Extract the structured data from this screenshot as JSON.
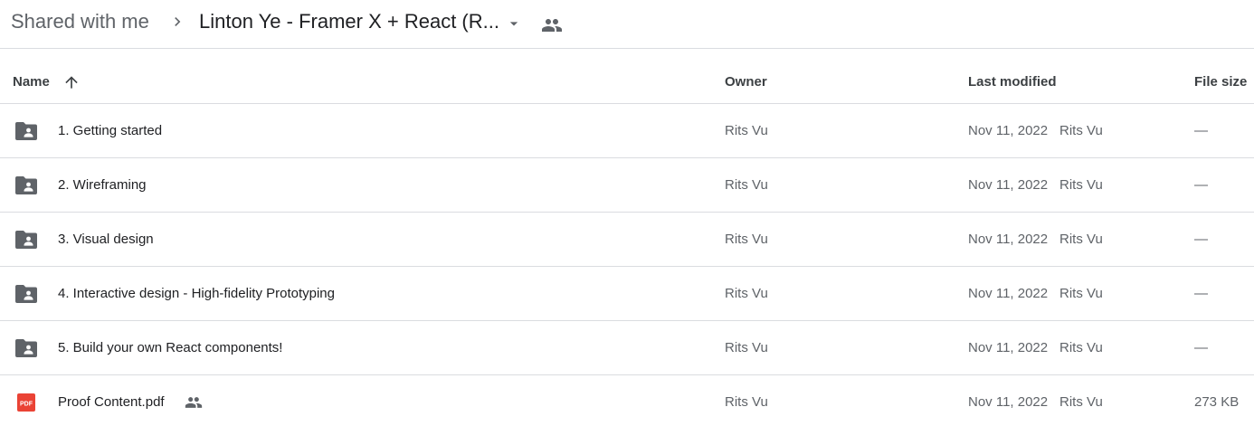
{
  "breadcrumb": {
    "root": "Shared with me",
    "current": "Linton Ye - Framer X + React (R..."
  },
  "columns": {
    "name": "Name",
    "owner": "Owner",
    "last_modified": "Last modified",
    "file_size": "File size"
  },
  "rows": [
    {
      "name": "1. Getting started",
      "type": "shared-folder",
      "owner": "Rits Vu",
      "modified_date": "Nov 11, 2022",
      "modified_by": "Rits Vu",
      "size": "—"
    },
    {
      "name": "2. Wireframing",
      "type": "shared-folder",
      "owner": "Rits Vu",
      "modified_date": "Nov 11, 2022",
      "modified_by": "Rits Vu",
      "size": "—"
    },
    {
      "name": "3. Visual design",
      "type": "shared-folder",
      "owner": "Rits Vu",
      "modified_date": "Nov 11, 2022",
      "modified_by": "Rits Vu",
      "size": "—"
    },
    {
      "name": "4. Interactive design - High-fidelity Prototyping",
      "type": "shared-folder",
      "owner": "Rits Vu",
      "modified_date": "Nov 11, 2022",
      "modified_by": "Rits Vu",
      "size": "—"
    },
    {
      "name": "5. Build your own React components!",
      "type": "shared-folder",
      "owner": "Rits Vu",
      "modified_date": "Nov 11, 2022",
      "modified_by": "Rits Vu",
      "size": "—"
    },
    {
      "name": "Proof Content.pdf",
      "type": "pdf",
      "owner": "Rits Vu",
      "modified_date": "Nov 11, 2022",
      "modified_by": "Rits Vu",
      "size": "273 KB"
    }
  ],
  "icons": {
    "breadcrumb_separator": "chevron-right-icon",
    "dropdown": "arrow-drop-down-icon",
    "shared": "people-icon",
    "sort": "arrow-upward-icon",
    "folder": "shared-folder-icon",
    "pdf": "pdf-file-icon",
    "pdf_badge_text": "PDF"
  },
  "colors": {
    "icon_gray": "#5f6368",
    "divider": "#dadce0",
    "pdf_red": "#ea4335",
    "text_primary": "#202124",
    "text_secondary": "#5f6368"
  }
}
